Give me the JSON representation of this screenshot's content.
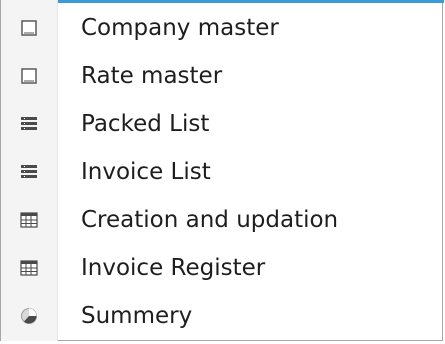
{
  "menu": {
    "items": [
      {
        "label": "Company master",
        "icon": "blank-document-icon"
      },
      {
        "label": "Rate master",
        "icon": "blank-document-icon"
      },
      {
        "label": "Packed List",
        "icon": "list-icon"
      },
      {
        "label": "Invoice List",
        "icon": "list-icon"
      },
      {
        "label": "Creation and updation",
        "icon": "table-grid-icon"
      },
      {
        "label": "Invoice Register",
        "icon": "table-grid-icon"
      },
      {
        "label": "Summery",
        "icon": "pie-chart-icon"
      }
    ]
  },
  "colors": {
    "accent": "#3c9bd6",
    "icon_gray": "#4a4a4a",
    "border": "#a7a7a7"
  }
}
